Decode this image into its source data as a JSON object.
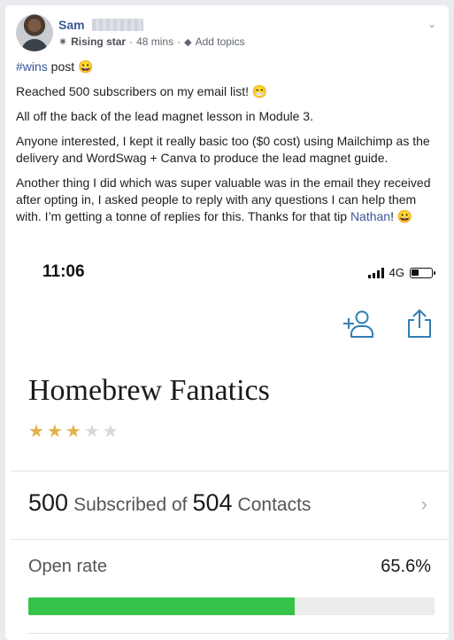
{
  "post": {
    "author": "Sam",
    "badge_icon": "star-badge-icon",
    "badge": "Rising star",
    "separator": "·",
    "time": "48 mins",
    "add_topics": "Add topics",
    "hashtag": "#wins",
    "line1_rest": " post 😀",
    "line2": "Reached 500 subscribers on my email list! 😁",
    "line3": "All off the back of the lead magnet lesson in Module 3.",
    "line4": "Anyone interested, I kept it really basic too ($0 cost) using Mailchimp as the delivery and WordSwag + Canva to produce the lead magnet guide.",
    "line5": "Another thing I did which was super valuable was in the email they received after opting in, I asked people to reply with any questions I can help them with. I’m getting a tonne of replies for this. Thanks for that tip ",
    "mention": "Nathan",
    "line5_end": "! 😀"
  },
  "screenshot": {
    "time": "11:06",
    "network": "4G",
    "list_name": "Homebrew Fanatics",
    "rating": 3,
    "rating_max": 5,
    "subscribed_count": "500",
    "subscribed_label": "Subscribed of",
    "contacts_count": "504",
    "contacts_label": "Contacts",
    "open_rate_label": "Open rate",
    "open_rate_value": "65.6%",
    "open_rate_fraction": 0.656,
    "accent_color": "#36c34a"
  }
}
